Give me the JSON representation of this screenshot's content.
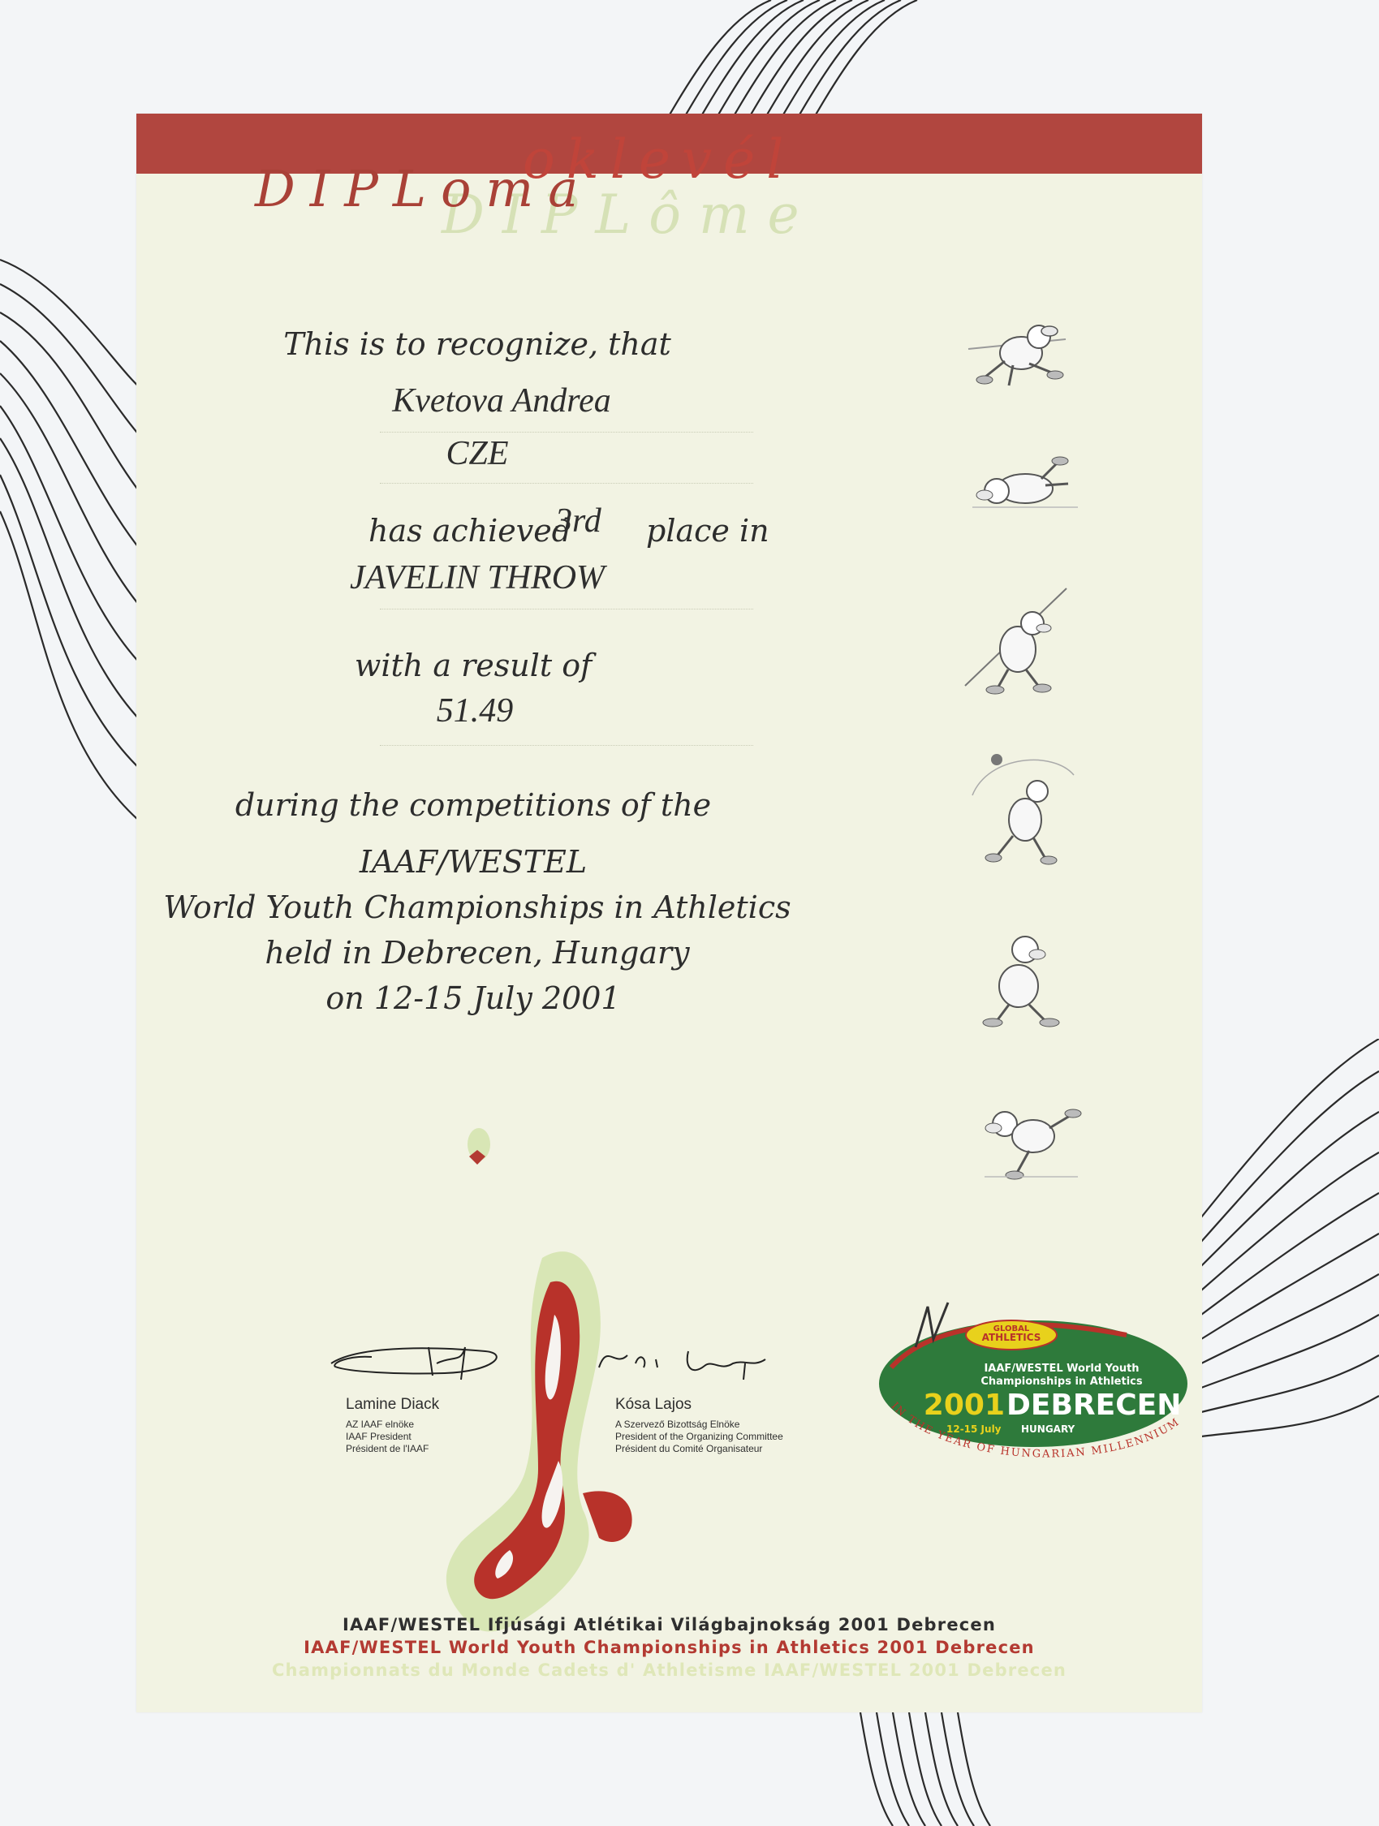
{
  "diploma": {
    "titles": {
      "hungarian": "oklevél",
      "english": "DIPLoma",
      "french": "DIPLôme"
    },
    "recognize_line": "This is to recognize, that",
    "athlete_name": "Kvetova Andrea",
    "country": "CZE",
    "achieved_prefix": "has achieved",
    "place": "3rd",
    "achieved_suffix": "place in",
    "event": "JAVELIN THROW",
    "result_prefix": "with a result of",
    "result": "51.49",
    "competition_intro": "during the competitions of the",
    "organizer": "IAAF/WESTEL",
    "championship": "World Youth Championships in Athletics",
    "location": "held in Debrecen, Hungary",
    "dates": "on 12-15 July 2001"
  },
  "signatures": [
    {
      "name": "Lamine Diack",
      "roles": [
        "AZ IAAF elnöke",
        "IAAF President",
        "Président de l'IAAF"
      ]
    },
    {
      "name": "Kósa Lajos",
      "roles": [
        "A Szervező Bizottság Elnöke",
        "President of the Organizing Committee",
        "Président du Comité Organisateur"
      ]
    }
  ],
  "logo": {
    "badge_line1": "GLOBAL",
    "badge_line2": "ATHLETICS",
    "title_line1": "IAAF/WESTEL World Youth",
    "title_line2": "Championships in Athletics",
    "year": "2001",
    "city": "DEBRECEN",
    "dates": "12-15 July",
    "country": "HUNGARY",
    "arc_text": "IN THE YEAR OF HUNGARIAN MILLENNIUM",
    "colors": {
      "green": "#2e7a3b",
      "red": "#b8322a",
      "yellow": "#e8d11c"
    }
  },
  "footer": {
    "hungarian": "IAAF/WESTEL Ifjúsági Atlétikai Világbajnokság 2001 Debrecen",
    "english": "IAAF/WESTEL World Youth Championships in Athletics 2001 Debrecen",
    "french": "Championnats du Monde Cadets d' Athletisme IAAF/WESTEL 2001 Debrecen"
  },
  "colors": {
    "band": "#b1463f",
    "paper": "#f2f3e3",
    "footer_hu": "#2f2f2f",
    "footer_en": "#b33a32",
    "footer_fr": "#dfe7b8"
  }
}
